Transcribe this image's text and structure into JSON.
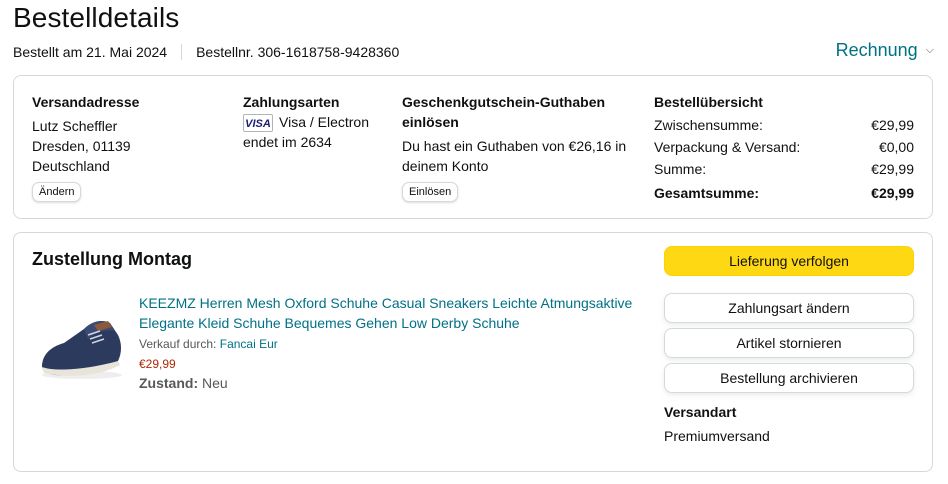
{
  "page": {
    "title": "Bestelldetails"
  },
  "order": {
    "date": "Bestellt am 21. Mai 2024",
    "number": "Bestellnr. 306-1618758-9428360"
  },
  "invoice": {
    "label": "Rechnung"
  },
  "address": {
    "title": "Versandadresse",
    "name": "Lutz Scheffler",
    "city": "Dresden, 01139",
    "country": "Deutschland",
    "change_label": "Ändern"
  },
  "payment": {
    "title": "Zahlungsarten",
    "card_brand": "VISA",
    "card_name": "Visa / Electron",
    "card_ending": "endet im 2634"
  },
  "giftcard": {
    "title": "Geschenkgutschein-Guthaben einlösen",
    "text": "Du hast ein Guthaben von €26,16 in deinem Konto",
    "redeem_label": "Einlösen"
  },
  "summary": {
    "title": "Bestellübersicht",
    "rows": [
      {
        "label": "Zwischensumme:",
        "value": "€29,99"
      },
      {
        "label": "Verpackung & Versand:",
        "value": "€0,00"
      },
      {
        "label": "Summe:",
        "value": "€29,99"
      }
    ],
    "total_label": "Gesamtsumme:",
    "total_value": "€29,99"
  },
  "delivery": {
    "title": "Zustellung Montag",
    "product": {
      "title": "KEEZMZ Herren Mesh Oxford Schuhe Casual Sneakers Leichte Atmungsaktive Elegante Kleid Schuhe Bequemes Gehen Low Derby Schuhe",
      "seller_prefix": "Verkauf durch:",
      "seller_name": "Fancai Eur",
      "price": "€29,99",
      "condition_label": "Zustand:",
      "condition_value": "Neu"
    },
    "actions": {
      "track": "Lieferung verfolgen",
      "change_payment": "Zahlungsart ändern",
      "cancel": "Artikel stornieren",
      "archive": "Bestellung archivieren"
    },
    "shipping_label": "Versandart",
    "shipping_value": "Premiumversand"
  },
  "colors": {
    "link": "#007185",
    "price": "#b12704",
    "primary_button": "#ffd814"
  },
  "icons": {
    "invoice_chevron": "chevron-down-icon",
    "card": "visa-card-icon"
  }
}
